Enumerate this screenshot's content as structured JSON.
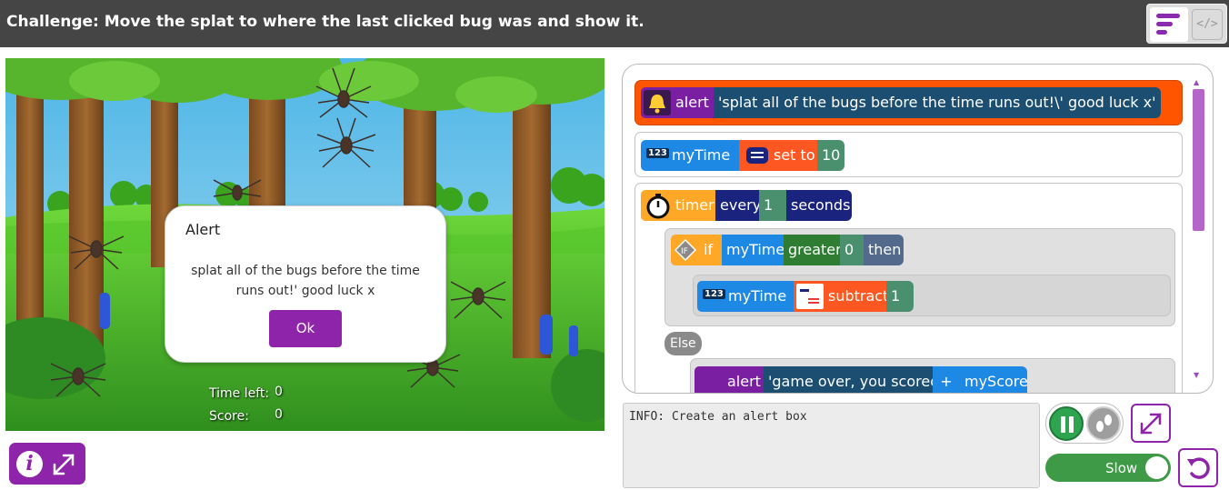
{
  "header": {
    "challenge_title": "Challenge: Move the splat to where the last clicked bug was and show it.",
    "code_toggle_label": "</>"
  },
  "game": {
    "alert": {
      "title": "Alert",
      "message": "splat all of the bugs before the time runs out!' good luck x",
      "ok_label": "Ok"
    },
    "hud": {
      "time_label": "Time left:",
      "time_value": "0",
      "score_label": "Score:",
      "score_value": "0"
    }
  },
  "editor": {
    "blocks": [
      {
        "keyword": "alert",
        "value": "'splat all of the bugs before the time runs out!\\' good luck x'"
      },
      {
        "variable": "myTime",
        "op": "set to",
        "value": "10"
      },
      {
        "keyword": "timer",
        "mode": "every",
        "value": "1",
        "unit": "seconds"
      },
      {
        "keyword": "if",
        "variable": "myTime",
        "op": "greater",
        "value": "0",
        "then": "then"
      },
      {
        "variable": "myTime",
        "op": "subtract",
        "value": "1"
      },
      {
        "keyword": "Else"
      },
      {
        "keyword": "alert",
        "value": "'game over, you scored '",
        "op": "+",
        "variable": "myScore"
      }
    ],
    "number_icon_text": "123"
  },
  "info_panel": {
    "text": "INFO: Create an alert box"
  },
  "controls": {
    "speed_label": "Slow"
  },
  "colors": {
    "purple_accent": "#8e24aa",
    "alert_block": "#ff5500",
    "string_chip": "#1c4e72",
    "variable_chip": "#1e88e5",
    "operator_chip": "#ff5722",
    "value_chip": "#4a8f6e",
    "timer_chip": "#ffa726",
    "every_chip": "#1a237e",
    "greater_chip": "#2e7d32",
    "then_chip": "#546a8c",
    "toggle_green": "#3e9a46"
  }
}
